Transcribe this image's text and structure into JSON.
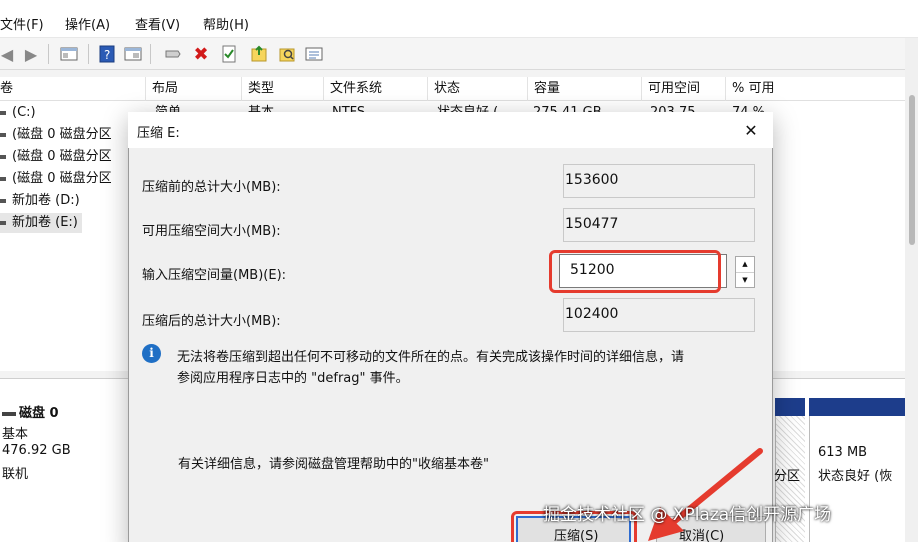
{
  "menu": {
    "items": [
      "文件(F)",
      "操作(A)",
      "查看(V)",
      "帮助(H)"
    ]
  },
  "toolbar": {
    "icons": [
      "back-icon",
      "forward-icon",
      "console-tree-icon",
      "help-icon",
      "properties-icon",
      "connect-disk-icon",
      "delete-icon",
      "checklist-icon",
      "open-folder-icon",
      "search-icon",
      "list-icon"
    ]
  },
  "list": {
    "columns": [
      "卷",
      "布局",
      "类型",
      "文件系统",
      "状态",
      "容量",
      "可用空间",
      "% 可用"
    ],
    "first_row": {
      "volume": "(C:)",
      "layout": "简单",
      "type": "基本",
      "fs": "NTFS",
      "status": "状态良好 (",
      "capacity": "275.41 GB",
      "free": "203.75",
      "pct": "74 %"
    },
    "volumes": [
      "(C:)",
      "(磁盘 0 磁盘分区",
      "(磁盘 0 磁盘分区",
      "(磁盘 0 磁盘分区",
      "新加卷 (D:)",
      "新加卷 (E:)"
    ]
  },
  "disk": {
    "name": "磁盘 0",
    "type": "基本",
    "size": "476.92 GB",
    "state": "联机",
    "partition_partial": "分区",
    "partition_size": "613 MB",
    "partition_status": "状态良好 (恢"
  },
  "dialog": {
    "title": "压缩 E:",
    "fields": {
      "total_before_label": "压缩前的总计大小(MB):",
      "total_before_value": "153600",
      "available_label": "可用压缩空间大小(MB):",
      "available_value": "150477",
      "input_label": "输入压缩空间量(MB)(E):",
      "input_value": "51200",
      "total_after_label": "压缩后的总计大小(MB):",
      "total_after_value": "102400"
    },
    "info_line1": "无法将卷压缩到超出任何不可移动的文件所在的点。有关完成该操作时间的详细信息，请",
    "info_line2": "参阅应用程序日志中的 \"defrag\" 事件。",
    "detail_text": "有关详细信息，请参阅磁盘管理帮助中的\"收缩基本卷\"",
    "shrink_button": "压缩(S)",
    "cancel_button": "取消(C)"
  },
  "watermark": "掘金技术社区 @ XPlaza信创开源广场",
  "colors": {
    "highlight_red": "#e53b2e",
    "partition_blue": "#1d3d8b",
    "focus_blue": "#2d6bd0"
  }
}
